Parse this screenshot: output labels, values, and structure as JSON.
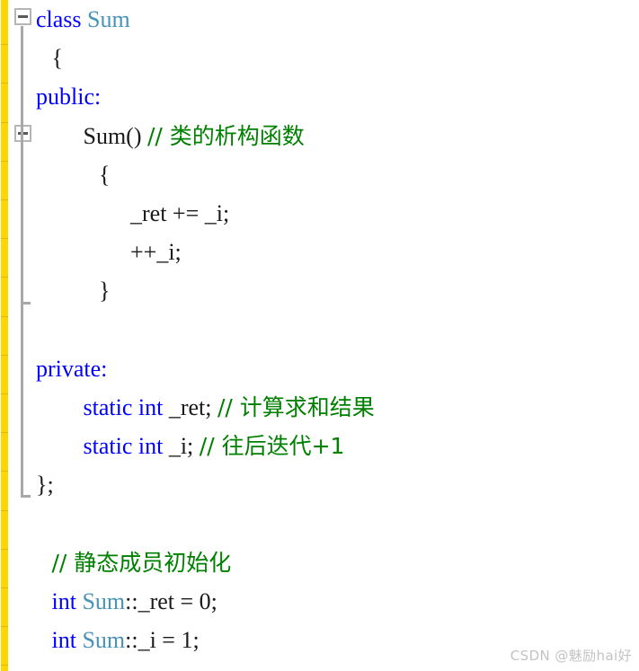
{
  "editor": {
    "language": "C++",
    "colors": {
      "keyword": "#0000ff",
      "type_identifier": "#4a93b8",
      "comment": "#008000",
      "plain_text": "#1a1a1a",
      "change_bar": "#ffd700",
      "fold_guide": "#a8a8a8",
      "background": "#ffffff"
    },
    "gutter": {
      "fold_boxes": [
        {
          "name": "fold-toggle-class-sum",
          "line": 1,
          "state": "expanded",
          "glyph": "minus"
        },
        {
          "name": "fold-toggle-constructor",
          "line": 4,
          "state": "expanded",
          "glyph": "minus"
        }
      ]
    },
    "lines": [
      {
        "number": 1,
        "indent": 0,
        "tokens": [
          {
            "text": "class ",
            "kind": "keyword"
          },
          {
            "text": "Sum",
            "kind": "type"
          }
        ]
      },
      {
        "number": 2,
        "indent": 1,
        "tokens": [
          {
            "text": "{",
            "kind": "plain"
          }
        ]
      },
      {
        "number": 3,
        "indent": 0,
        "tokens": [
          {
            "text": "public:",
            "kind": "keyword"
          }
        ]
      },
      {
        "number": 4,
        "indent": 3,
        "tokens": [
          {
            "text": "Sum() ",
            "kind": "plain"
          },
          {
            "text": "// 类的析构函数",
            "kind": "comment"
          }
        ]
      },
      {
        "number": 5,
        "indent": 4,
        "tokens": [
          {
            "text": "{",
            "kind": "plain"
          }
        ]
      },
      {
        "number": 6,
        "indent": 6,
        "tokens": [
          {
            "text": "_ret += _i;",
            "kind": "plain"
          }
        ]
      },
      {
        "number": 7,
        "indent": 6,
        "tokens": [
          {
            "text": "++_i;",
            "kind": "plain"
          }
        ]
      },
      {
        "number": 8,
        "indent": 4,
        "tokens": [
          {
            "text": "}",
            "kind": "plain"
          }
        ]
      },
      {
        "number": 9,
        "indent": 0,
        "tokens": []
      },
      {
        "number": 10,
        "indent": 0,
        "tokens": [
          {
            "text": "private:",
            "kind": "keyword"
          }
        ]
      },
      {
        "number": 11,
        "indent": 3,
        "tokens": [
          {
            "text": "static int ",
            "kind": "keyword"
          },
          {
            "text": "_ret; ",
            "kind": "plain"
          },
          {
            "text": "// 计算求和结果",
            "kind": "comment"
          }
        ]
      },
      {
        "number": 12,
        "indent": 3,
        "tokens": [
          {
            "text": "static int ",
            "kind": "keyword"
          },
          {
            "text": "_i; ",
            "kind": "plain"
          },
          {
            "text": "// 往后迭代+1",
            "kind": "comment"
          }
        ]
      },
      {
        "number": 13,
        "indent": 0,
        "tokens": [
          {
            "text": "};",
            "kind": "plain"
          }
        ]
      },
      {
        "number": 14,
        "indent": 0,
        "tokens": []
      },
      {
        "number": 15,
        "indent": 1,
        "tokens": [
          {
            "text": "// 静态成员初始化",
            "kind": "comment"
          }
        ]
      },
      {
        "number": 16,
        "indent": 1,
        "tokens": [
          {
            "text": "int ",
            "kind": "keyword"
          },
          {
            "text": "Sum",
            "kind": "type"
          },
          {
            "text": "::_ret = 0;",
            "kind": "plain"
          }
        ]
      },
      {
        "number": 17,
        "indent": 1,
        "tokens": [
          {
            "text": "int ",
            "kind": "keyword"
          },
          {
            "text": "Sum",
            "kind": "type"
          },
          {
            "text": "::_i = 1;",
            "kind": "plain"
          }
        ]
      }
    ]
  },
  "watermark": {
    "text": "CSDN @魅励hai好"
  }
}
